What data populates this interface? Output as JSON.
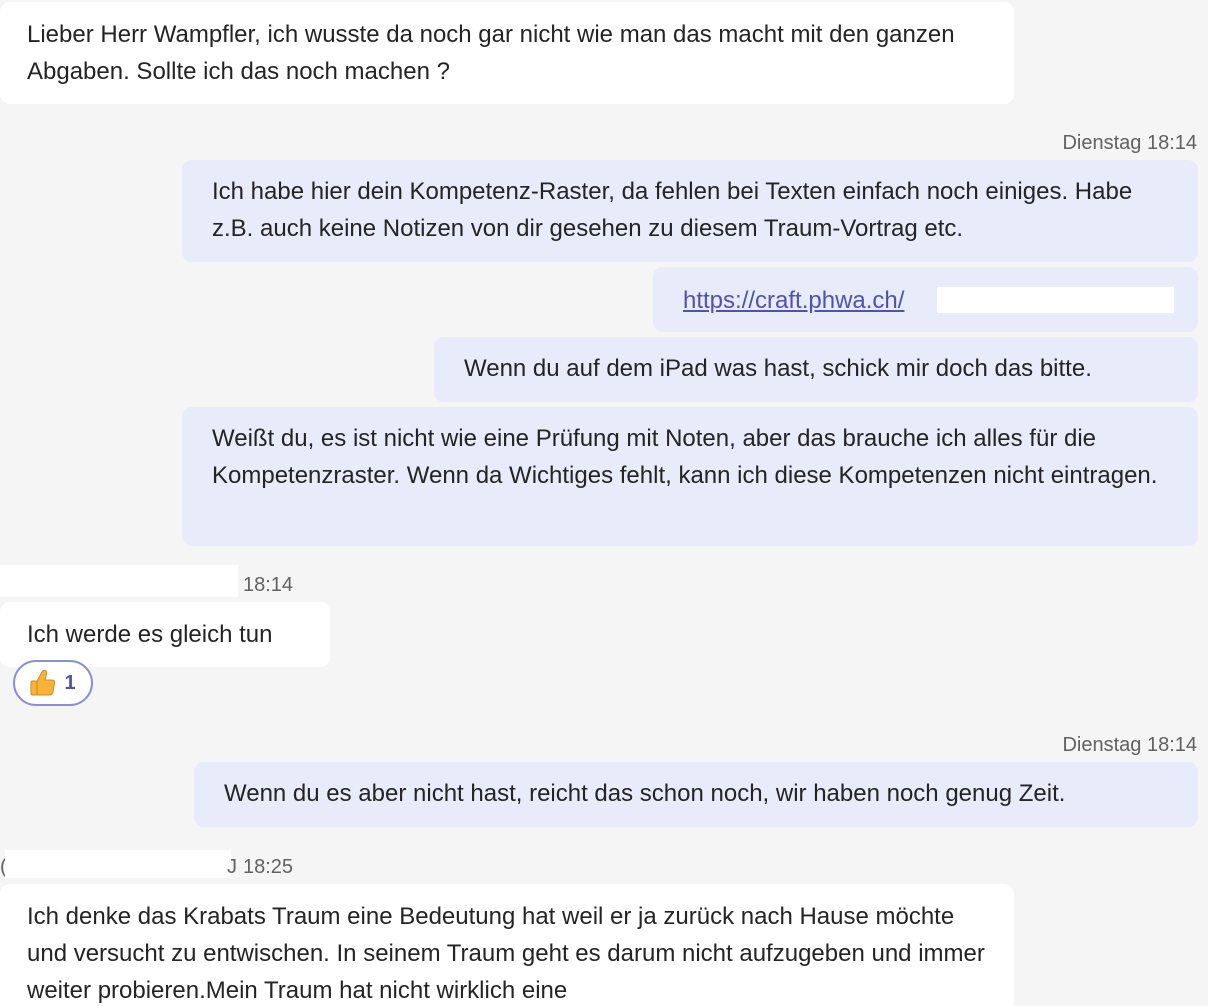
{
  "messages": [
    {
      "direction": "incoming",
      "text": "Lieber Herr Wampfler, ich wusste da noch gar nicht wie man das macht mit den ganzen Abgaben. Sollte ich das noch machen ?"
    },
    {
      "direction": "outgoing",
      "timestamp": "Dienstag 18:14",
      "text": "Ich habe hier dein Kompetenz-Raster, da fehlen bei Texten einfach noch einiges. Habe z.B. auch keine Notizen von dir gesehen zu diesem Traum-Vortrag etc."
    },
    {
      "direction": "outgoing",
      "link": "https://craft.phwa.ch/"
    },
    {
      "direction": "outgoing",
      "text": "Wenn du auf dem iPad was hast, schick mir doch das bitte."
    },
    {
      "direction": "outgoing",
      "text": "Weißt du, es ist nicht wie eine Prüfung mit Noten, aber das brauche ich alles für die Kompetenzraster. Wenn da Wichtiges fehlt, kann ich diese Kompetenzen nicht eintragen."
    },
    {
      "direction": "incoming",
      "timestamp": "18:14",
      "text": "Ich werde es gleich tun",
      "reaction": {
        "emoji": "thumbs-up-icon",
        "count": "1"
      }
    },
    {
      "direction": "outgoing",
      "timestamp": "Dienstag 18:14",
      "text": "Wenn du es aber nicht hast, reicht das schon noch, wir haben noch genug Zeit."
    },
    {
      "direction": "incoming",
      "timestamp": "18:25",
      "timestamp_prefix": "( ",
      "timestamp_prefix_end": "J",
      "text": "Ich denke das Krabats Traum eine Bedeutung hat weil er ja zurück nach Hause möchte und versucht zu entwischen. In seinem Traum geht es darum nicht aufzugeben und immer weiter probieren.Mein Traum hat nicht wirklich eine"
    }
  ],
  "colors": {
    "background": "#f5f5f5",
    "incoming_bubble": "#ffffff",
    "outgoing_bubble": "#e8ebfa",
    "link": "#4f52b2",
    "reaction_border": "#8b8fd8"
  }
}
